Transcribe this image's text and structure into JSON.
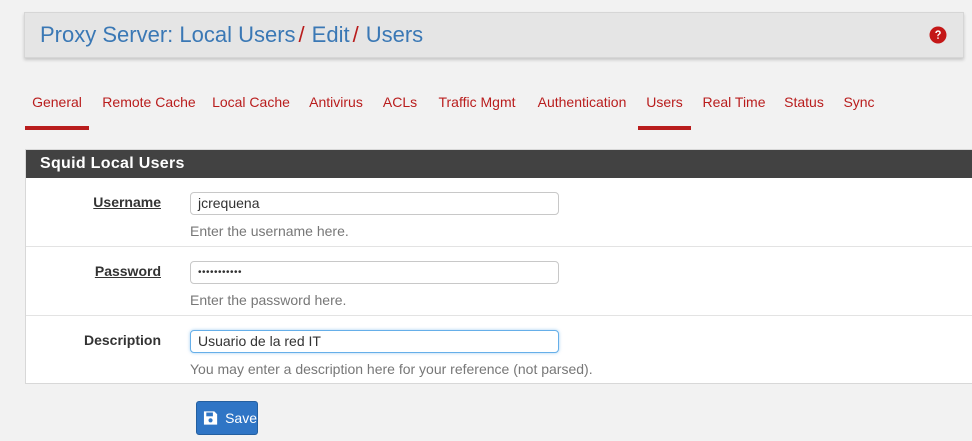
{
  "header": {
    "crumbs": [
      "Proxy Server: Local Users",
      "Edit",
      "Users"
    ],
    "help_icon": "question-circle-icon"
  },
  "tabs": [
    {
      "label": "General",
      "active": true
    },
    {
      "label": "Remote Cache",
      "active": false
    },
    {
      "label": "Local Cache",
      "active": false
    },
    {
      "label": "Antivirus",
      "active": false
    },
    {
      "label": "ACLs",
      "active": false
    },
    {
      "label": "Traffic Mgmt",
      "active": false
    },
    {
      "label": "Authentication",
      "active": false
    },
    {
      "label": "Users",
      "active": true
    },
    {
      "label": "Real Time",
      "active": false
    },
    {
      "label": "Status",
      "active": false
    },
    {
      "label": "Sync",
      "active": false
    }
  ],
  "panel": {
    "title": "Squid Local Users",
    "fields": [
      {
        "label": "Username",
        "value": "jcrequena",
        "hint": "Enter the username here.",
        "required": true
      },
      {
        "label": "Password",
        "value": "•••••••••••",
        "hint": "Enter the password here.",
        "required": true
      },
      {
        "label": "Description",
        "value": "Usuario de la red IT",
        "hint": "You may enter a description here for your reference (not parsed).",
        "required": false
      }
    ]
  },
  "save_button": {
    "label": "Save",
    "icon": "floppy-disk-icon"
  },
  "colors": {
    "accent_red": "#b91d1d",
    "link_blue": "#3a78b5",
    "panel_heading": "#424242",
    "button_blue": "#2f75c5"
  }
}
